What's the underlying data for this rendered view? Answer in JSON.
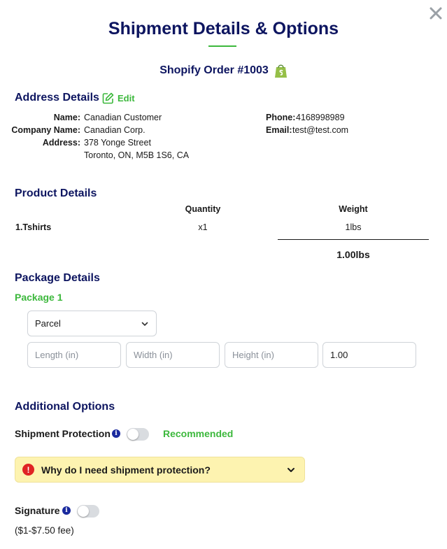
{
  "modal": {
    "title": "Shipment Details & Options",
    "order_label": "Shopify Order #1003",
    "close_icon": "close-icon"
  },
  "colors": {
    "navy": "#0d1560",
    "green": "#3cb83c",
    "info_blue": "#1a2a9e",
    "alert_red": "#e02424",
    "accordion_bg": "#fdf3b0"
  },
  "address": {
    "section_title": "Address Details",
    "edit_label": "Edit",
    "name_label": "Name:",
    "name": "Canadian Customer",
    "company_label": "Company Name:",
    "company": "Canadian Corp.",
    "address_label": "Address:",
    "address_line1": "378 Yonge Street",
    "address_line2": "Toronto, ON, M5B 1S6, CA",
    "phone_label": "Phone:",
    "phone": "4168998989",
    "email_label": "Email:",
    "email": "test@test.com"
  },
  "products": {
    "section_title": "Product Details",
    "headers": {
      "quantity": "Quantity",
      "weight": "Weight"
    },
    "rows": [
      {
        "name": "1.Tshirts",
        "quantity": "x1",
        "weight": "1lbs"
      }
    ],
    "total_weight": "1.00lbs"
  },
  "packages": {
    "section_title": "Package Details",
    "package_label": "Package 1",
    "type_selected": "Parcel",
    "length_placeholder": "Length (in)",
    "width_placeholder": "Width (in)",
    "height_placeholder": "Height (in)",
    "weight_value": "1.00"
  },
  "options": {
    "section_title": "Additional Options",
    "protection_label": "Shipment Protection",
    "protection_on": false,
    "recommended": "Recommended",
    "faq_question": "Why do I need shipment protection?",
    "signature_label": "Signature",
    "signature_on": false,
    "signature_fee": "($1-$7.50 fee)"
  }
}
